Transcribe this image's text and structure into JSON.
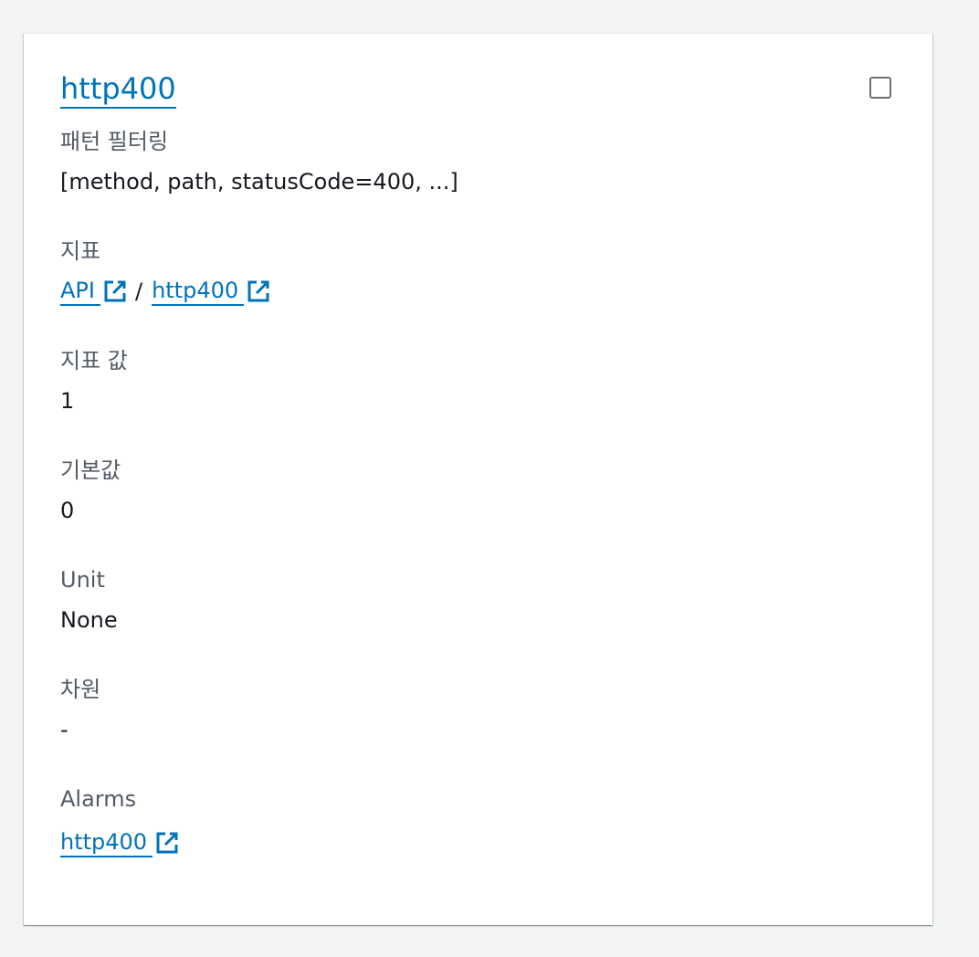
{
  "filter": {
    "title": "http400",
    "fields": {
      "pattern": {
        "label": "패턴 필터링",
        "value": "[method, path, statusCode=400, ...]"
      },
      "metric": {
        "label": "지표",
        "namespace_link": "API",
        "separator": "/",
        "metric_link": "http400"
      },
      "metric_value": {
        "label": "지표 값",
        "value": "1"
      },
      "default_value": {
        "label": "기본값",
        "value": "0"
      },
      "unit": {
        "label": "Unit",
        "value": "None"
      },
      "dimensions": {
        "label": "차원",
        "value": "-"
      },
      "alarms": {
        "label": "Alarms",
        "alarm_link": "http400"
      }
    }
  },
  "icons": {
    "external_link": "external-link-icon",
    "checkbox": "checkbox-unchecked"
  },
  "colors": {
    "link": "#0073bb",
    "label": "#545b64",
    "text": "#16191f",
    "background": "#f2f3f3",
    "card": "#ffffff"
  }
}
